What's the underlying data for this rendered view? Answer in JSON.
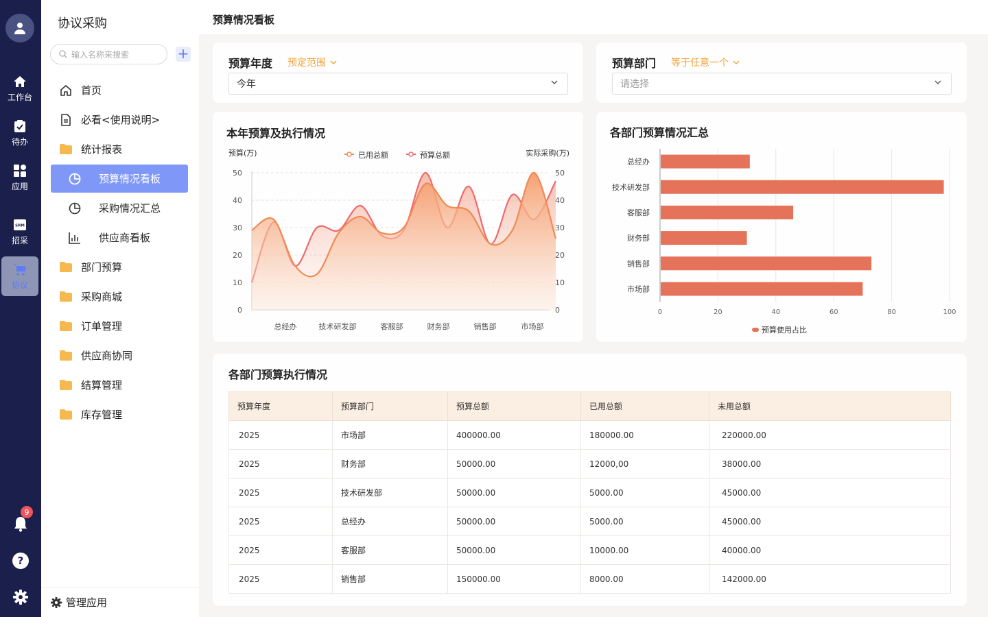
{
  "rail": {
    "items": [
      {
        "label": "工作台",
        "icon": "home-icon"
      },
      {
        "label": "待办",
        "icon": "clipboard-check-icon"
      },
      {
        "label": "应用",
        "icon": "apps-grid-icon"
      },
      {
        "label": "招采",
        "icon": "srm-icon",
        "icon_text": "SRM"
      },
      {
        "label": "协议",
        "icon": "cart-icon",
        "active": true
      }
    ],
    "notification_count": "9"
  },
  "sidebar": {
    "title": "协议采购",
    "search_placeholder": "输入名称来搜索",
    "add_label": "+",
    "items": [
      {
        "label": "首页",
        "icon": "home-outline-icon"
      },
      {
        "label": "必看<使用说明>",
        "icon": "document-icon"
      },
      {
        "label": "统计报表",
        "icon": "folder-icon"
      },
      {
        "label": "预算情况看板",
        "icon": "pie-chart-icon",
        "sub": true,
        "active": true
      },
      {
        "label": "采购情况汇总",
        "icon": "pie-chart-icon",
        "sub": true
      },
      {
        "label": "供应商看板",
        "icon": "bar-chart-icon",
        "sub": true
      },
      {
        "label": "部门预算",
        "icon": "folder-icon"
      },
      {
        "label": "采购商城",
        "icon": "folder-icon"
      },
      {
        "label": "订单管理",
        "icon": "folder-icon"
      },
      {
        "label": "供应商协同",
        "icon": "folder-icon"
      },
      {
        "label": "结算管理",
        "icon": "folder-icon"
      },
      {
        "label": "库存管理",
        "icon": "folder-icon"
      }
    ],
    "footer_label": "管理应用"
  },
  "page": {
    "title": "预算情况看板"
  },
  "filters": {
    "year": {
      "label": "预算年度",
      "mode": "预定范围",
      "value": "今年"
    },
    "dept": {
      "label": "预算部门",
      "mode": "等于任意一个",
      "placeholder": "请选择"
    }
  },
  "colors": {
    "accent": "#7f98f8",
    "orange": "#f0a43a",
    "bar": "#e4735a",
    "line_used": "#ef8a55",
    "line_budget": "#ee6a6e"
  },
  "charts": {
    "budget_exec": {
      "title": "本年预算及执行情况",
      "ylabel_left": "预算(万)",
      "ylabel_right": "实际采购(万)"
    },
    "dept_summary": {
      "title": "各部门预算情况汇总"
    }
  },
  "chart_data": [
    {
      "type": "area",
      "title": "本年预算及执行情况",
      "categories": [
        "总经办",
        "技术研发部",
        "客服部",
        "财务部",
        "销售部",
        "市场部"
      ],
      "ylim": [
        0,
        50
      ],
      "yticks": [
        0,
        10,
        20,
        30,
        40,
        50
      ],
      "ylim_right": [
        0,
        50
      ],
      "yticks_right": [
        0,
        10,
        20,
        30,
        40,
        50
      ],
      "grid": true,
      "legend": "top-center",
      "series": [
        {
          "name": "已用总额",
          "values": [
            29,
            33,
            16,
            13,
            28,
            34,
            28,
            30,
            46,
            38,
            36,
            24,
            29,
            50,
            26
          ]
        },
        {
          "name": "预算总额",
          "values": [
            10,
            32,
            16,
            30,
            29,
            38,
            27,
            29,
            50,
            30,
            45,
            24,
            42,
            33,
            47
          ]
        }
      ]
    },
    {
      "type": "bar",
      "orientation": "horizontal",
      "title": "各部门预算情况汇总",
      "categories": [
        "总经办",
        "技术研发部",
        "客服部",
        "财务部",
        "销售部",
        "市场部"
      ],
      "values": [
        31,
        98,
        46,
        30,
        73,
        70
      ],
      "xlim": [
        0,
        100
      ],
      "xticks": [
        0,
        20,
        40,
        60,
        80,
        100
      ],
      "series": [
        {
          "name": "预算使用占比"
        }
      ],
      "grid": true,
      "legend": "bottom-center"
    }
  ],
  "table": {
    "title": "各部门预算执行情况",
    "columns": [
      "预算年度",
      "预算部门",
      "预算总额",
      "已用总额",
      "未用总额"
    ],
    "rows": [
      [
        "2025",
        "市场部",
        "400000.00",
        "180000.00",
        "220000.00"
      ],
      [
        "2025",
        "财务部",
        "50000.00",
        "12000,00",
        "38000.00"
      ],
      [
        "2025",
        "技术研发部",
        "50000.00",
        "5000.00",
        "45000.00"
      ],
      [
        "2025",
        "总经办",
        "50000.00",
        "5000.00",
        "45000.00"
      ],
      [
        "2025",
        "客服部",
        "50000.00",
        "10000.00",
        "40000.00"
      ],
      [
        "2025",
        "销售部",
        "150000.00",
        "8000.00",
        "142000.00"
      ]
    ]
  }
}
